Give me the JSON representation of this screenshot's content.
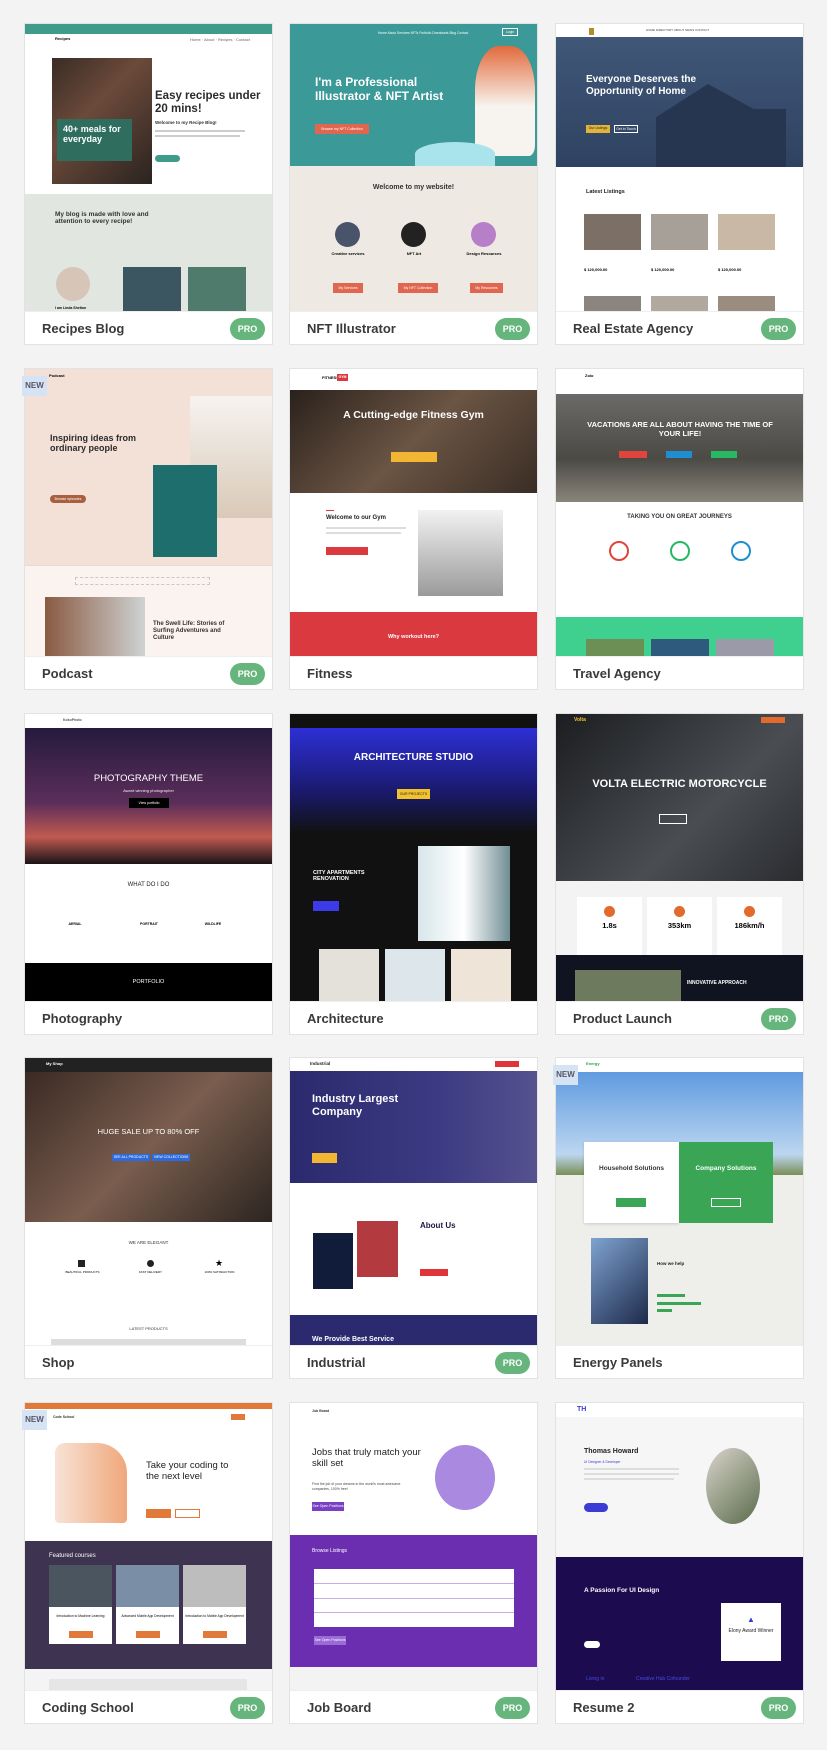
{
  "badges": {
    "pro": "PRO",
    "new": "NEW"
  },
  "colors": {
    "pro_badge": "#66b57c",
    "new_badge": "#d5e3f4",
    "page_bg": "#f3f3f3"
  },
  "cards": [
    {
      "name": "Recipes Blog",
      "pro": true,
      "thumb": {
        "logo": "Recipes",
        "nav": "Home · About · Recipes · Contact",
        "title": "Easy recipes under 20 mins!",
        "subtitle": "Welcome to my Recipe Blog!",
        "promo": "40+ meals for everyday",
        "section": "My blog is made with love and attention to every recipe!",
        "caption": "I am Linda Shelton"
      }
    },
    {
      "name": "NFT Illustrator",
      "pro": true,
      "thumb": {
        "nav": "Home About Services NFTs Portfolio Downloads Blog Contact",
        "login": "Login",
        "title": "I'm a Professional Illustrator & NFT Artist",
        "button": "Browse my NFT Collection",
        "welcome": "Welcome to my website!",
        "features": [
          {
            "label": "Creative services",
            "button": "My Services"
          },
          {
            "label": "NFT Art",
            "button": "My NFT Collection"
          },
          {
            "label": "Design Resources",
            "button": "My Resources"
          }
        ]
      }
    },
    {
      "name": "Real Estate Agency",
      "pro": true,
      "thumb": {
        "nav": "HOME DIRECTORY ABOUT NEWS CONTACT",
        "title": "Everyone Deserves the Opportunity of Home",
        "buttons": [
          "Our Listings",
          "Get in Touch"
        ],
        "section": "Latest Listings",
        "prices": [
          "$ 120,000.00",
          "$ 120,000.00",
          "$ 120,000.00"
        ]
      }
    },
    {
      "name": "Podcast",
      "pro": true,
      "new": true,
      "thumb": {
        "logo": "Podcast",
        "title": "Inspiring ideas from ordinary people",
        "button": "Browse episodes",
        "post": "The Swell Life: Stories of Surfing Adventures and Culture"
      }
    },
    {
      "name": "Fitness",
      "pro": false,
      "thumb": {
        "logo": "FITNESS",
        "logo_tag": "GYM",
        "title": "A Cutting-edge Fitness Gym",
        "welcome": "Welcome to our Gym",
        "band": "Why workout here?"
      }
    },
    {
      "name": "Travel Agency",
      "pro": false,
      "thumb": {
        "logo": "Zolo",
        "title": "VACATIONS ARE ALL ABOUT HAVING THE TIME OF YOUR LIFE!",
        "section": "TAKING YOU ON GREAT JOURNEYS"
      }
    },
    {
      "name": "Photography",
      "pro": false,
      "thumb": {
        "logo": "KokoPhoto",
        "title": "PHOTOGRAPHY THEME",
        "subtitle": "Award winning photographer",
        "button": "View portfolio",
        "section": "WHAT DO I DO",
        "features": [
          "AERIAL",
          "PORTRAIT",
          "WILDLIFE"
        ],
        "band": "PORTFOLIO"
      }
    },
    {
      "name": "Architecture",
      "pro": false,
      "thumb": {
        "title": "ARCHITECTURE STUDIO",
        "button": "OUR PROJECTS",
        "section": "CITY APARTMENTS RENOVATION"
      }
    },
    {
      "name": "Product Launch",
      "pro": true,
      "thumb": {
        "logo": "Volta",
        "title": "VOLTA ELECTRIC MOTORCYCLE",
        "stats": [
          "1.8s",
          "353km",
          "186km/h"
        ],
        "band": "INNOVATIVE APPROACH"
      }
    },
    {
      "name": "Shop",
      "pro": false,
      "thumb": {
        "logo": "My Shop",
        "title": "HUGE SALE UP TO 80% OFF",
        "buttons": [
          "SEE ALL PRODUCTS",
          "VIEW COLLECTIONS"
        ],
        "section": "WE ARE ELEGANT",
        "features": [
          "BEAUTIFUL PRODUCTS",
          "FAST DELIVERY",
          "100% SATISFACTION"
        ],
        "section2": "LATEST PRODUCTS"
      }
    },
    {
      "name": "Industrial",
      "pro": true,
      "thumb": {
        "logo": "Industrial",
        "title": "Industry Largest Company",
        "section": "About Us",
        "band": "We Provide Best Service"
      }
    },
    {
      "name": "Energy Panels",
      "pro": false,
      "new": true,
      "thumb": {
        "logo": "Energy",
        "box1": "Household Solutions",
        "box2": "Company Solutions",
        "section": "How we help"
      }
    },
    {
      "name": "Coding School",
      "pro": true,
      "new": true,
      "thumb": {
        "logo": "Code School",
        "title": "Take your coding to the next level",
        "section": "Featured courses",
        "courses": [
          "Introduction to Machine Learning",
          "Advanced Mobile App Development",
          "Introduction to Mobile App Development"
        ]
      }
    },
    {
      "name": "Job Board",
      "pro": true,
      "thumb": {
        "logo": "Job Board",
        "title": "Jobs that truly match your skill set",
        "subtitle": "Find the job of your dreams in the world's most awesome companies, 100% free!",
        "button": "See Open Positions",
        "section": "Browse Listings",
        "button2": "See Open Positions"
      }
    },
    {
      "name": "Resume 2",
      "pro": true,
      "thumb": {
        "logo": "TH",
        "title": "Thomas Howard",
        "subtitle": "UI Designer & Developer",
        "section": "A Passion For UI Design",
        "award": "Elony Award Winner",
        "links": [
          "Living in",
          "Creative Hub Cofounder"
        ]
      }
    }
  ]
}
